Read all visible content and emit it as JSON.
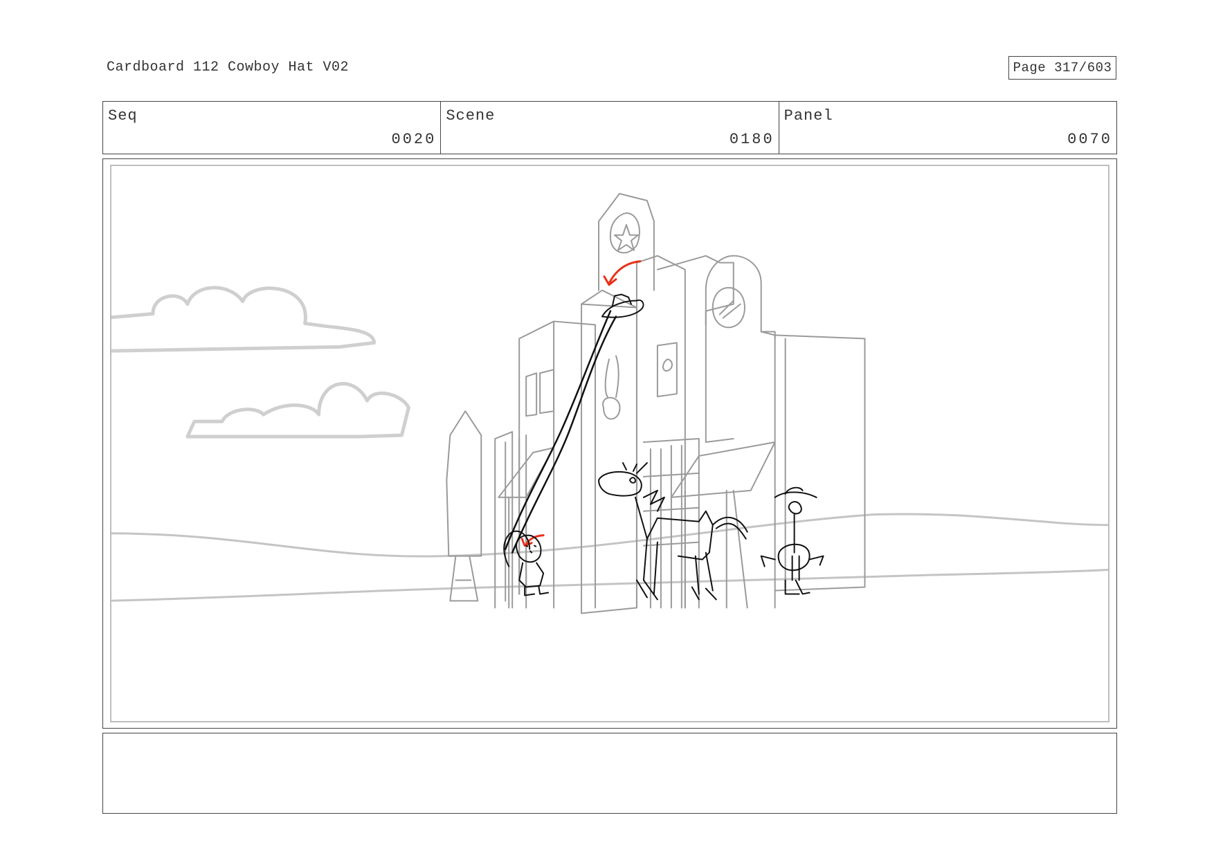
{
  "document": {
    "title": "Cardboard 112 Cowboy Hat V02",
    "page": "Page 317/603"
  },
  "header": {
    "seq": {
      "label": "Seq",
      "value": "0020"
    },
    "scene": {
      "label": "Scene",
      "value": "0180"
    },
    "panel": {
      "label": "Panel",
      "value": "0070"
    }
  },
  "notes": {
    "text": ""
  },
  "colors": {
    "frame": "#444444",
    "sketch_light": "#9a9a9a",
    "sketch_dark": "#111111",
    "arrow_red": "#e8311a"
  }
}
